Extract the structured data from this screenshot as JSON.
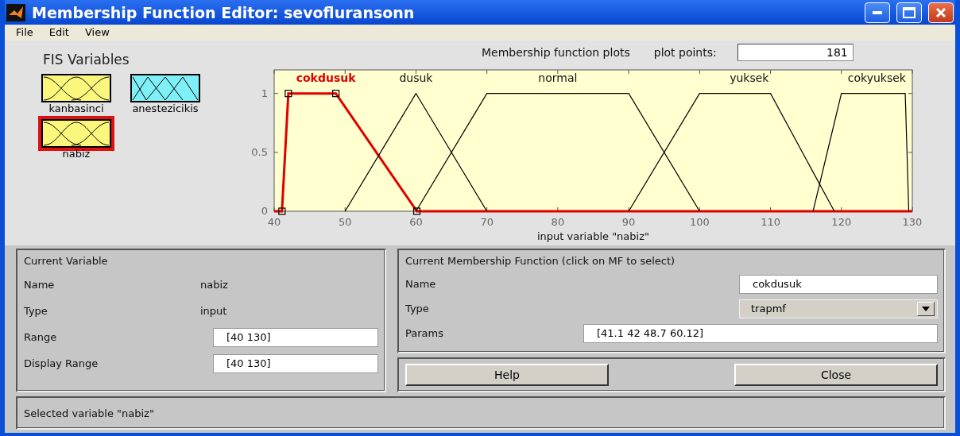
{
  "window": {
    "title": "Membership Function Editor: sevofluransonn"
  },
  "menu": [
    "File",
    "Edit",
    "View"
  ],
  "fis_variables": {
    "title": "FIS Variables",
    "items": [
      {
        "name": "kanbasinci",
        "kind": "input",
        "selected": false
      },
      {
        "name": "anestezicikis",
        "kind": "output",
        "selected": false
      },
      {
        "name": "nabiz",
        "kind": "input",
        "selected": true
      }
    ]
  },
  "plot": {
    "title": "Membership function plots",
    "plot_points_label": "plot points:",
    "plot_points": "181",
    "mf_states": [
      {
        "selected": true
      },
      {
        "selected": false
      },
      {
        "selected": false
      },
      {
        "selected": false
      },
      {
        "selected": false
      }
    ],
    "chart_data": {
      "type": "line",
      "xlabel": "input variable \"nabiz\"",
      "x": [
        40,
        41.1,
        42,
        48.7,
        50,
        60,
        60.12,
        70,
        90,
        100,
        110,
        116,
        119,
        120,
        129,
        129.5,
        130
      ],
      "series": [
        {
          "name": "cokdusuk",
          "color": "#e00000",
          "values": [
            0,
            0,
            1,
            1,
            0.886,
            0.011,
            0,
            0,
            0,
            0,
            0,
            0,
            0,
            0,
            0,
            0,
            0
          ]
        },
        {
          "name": "dusuk",
          "color": "#000000",
          "values": [
            null,
            null,
            null,
            null,
            0,
            1,
            0.988,
            0,
            null,
            null,
            null,
            null,
            null,
            null,
            null,
            null,
            null
          ]
        },
        {
          "name": "normal",
          "color": "#000000",
          "values": [
            null,
            null,
            null,
            null,
            null,
            0,
            0.012,
            1,
            1,
            0,
            null,
            null,
            null,
            null,
            null,
            null,
            null
          ]
        },
        {
          "name": "yuksek",
          "color": "#000000",
          "values": [
            null,
            null,
            null,
            null,
            null,
            null,
            null,
            null,
            0,
            1,
            1,
            0.333,
            0,
            null,
            null,
            null,
            null
          ]
        },
        {
          "name": "cokyuksek",
          "color": "#000000",
          "values": [
            null,
            null,
            null,
            null,
            null,
            null,
            null,
            null,
            null,
            null,
            null,
            0,
            0.75,
            1,
            1,
            0,
            null
          ]
        }
      ],
      "xlim": [
        40,
        130
      ],
      "ylim": [
        0,
        1.2
      ],
      "xticks": [
        40,
        50,
        60,
        70,
        80,
        90,
        100,
        110,
        120,
        130
      ],
      "yticks": [
        0,
        0.5,
        1
      ]
    }
  },
  "current_variable": {
    "title": "Current Variable",
    "rows": [
      {
        "label": "Name",
        "kind": "text",
        "value": "nabiz"
      },
      {
        "label": "Type",
        "kind": "text",
        "value": "input"
      },
      {
        "label": "Range",
        "kind": "field",
        "value": "[40 130]"
      },
      {
        "label": "Display Range",
        "kind": "field",
        "value": "[40 130]"
      }
    ]
  },
  "current_mf": {
    "title": "Current Membership Function (click on MF to select)",
    "rows": [
      {
        "label": "Name",
        "kind": "field",
        "value": "cokdusuk"
      },
      {
        "label": "Type",
        "kind": "dropdown",
        "value": "trapmf"
      },
      {
        "label": "Params",
        "kind": "wide",
        "value": "[41.1 42 48.7 60.12]"
      }
    ]
  },
  "buttons": [
    "Help",
    "Close"
  ],
  "status": "Selected variable \"nabiz\""
}
